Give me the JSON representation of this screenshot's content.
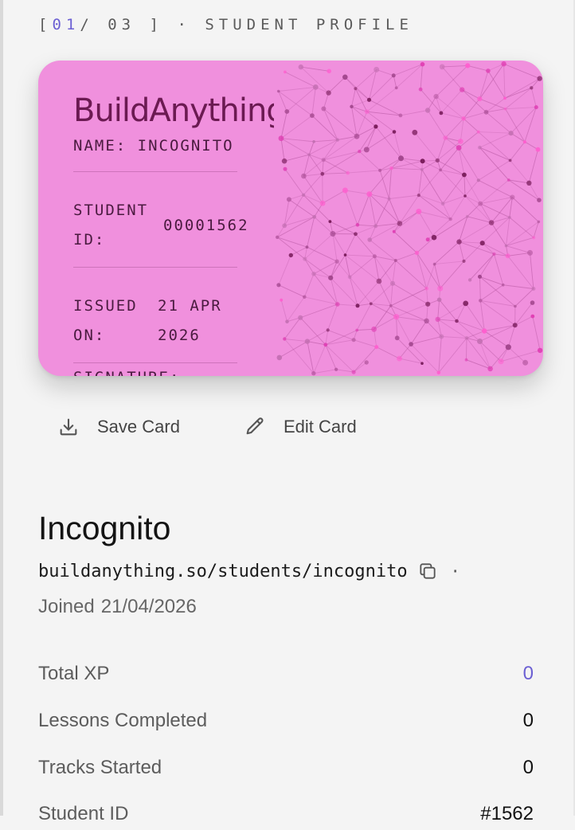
{
  "header": {
    "open_bracket": "[",
    "current_index": "01",
    "total": "/ 03 ]",
    "separator": "·",
    "title": "STUDENT PROFILE"
  },
  "card": {
    "brand": "BuildAnything",
    "name_line": "NAME: INCOGNITO",
    "student_id_label_1": "STUDENT",
    "student_id_label_2": "ID:",
    "student_id_value": "00001562",
    "issued_label_1": "ISSUED",
    "issued_label_2": "ON:",
    "issued_value_1": "21 APR",
    "issued_value_2": "2026",
    "signature_label": "SIGNATURE:",
    "background_color": "#f090dd",
    "pattern": "network-dots"
  },
  "actions": {
    "save_label": "Save Card",
    "save_icon": "download-icon",
    "edit_label": "Edit Card",
    "edit_icon": "pencil-icon"
  },
  "profile": {
    "name": "Incognito",
    "url": "buildanything.so/students/incognito",
    "copy_icon": "copy-icon",
    "url_separator": "·",
    "joined_label": "Joined",
    "joined_date": "21/04/2026"
  },
  "stats": [
    {
      "label": "Total XP",
      "value": "0",
      "accent": true
    },
    {
      "label": "Lessons Completed",
      "value": "0",
      "accent": false
    },
    {
      "label": "Tracks Started",
      "value": "0",
      "accent": false
    },
    {
      "label": "Student ID",
      "value": "#1562",
      "accent": false
    }
  ],
  "colors": {
    "accent": "#6b5fd3",
    "page_background": "#f4f4f4",
    "card_pink": "#f090dd"
  }
}
